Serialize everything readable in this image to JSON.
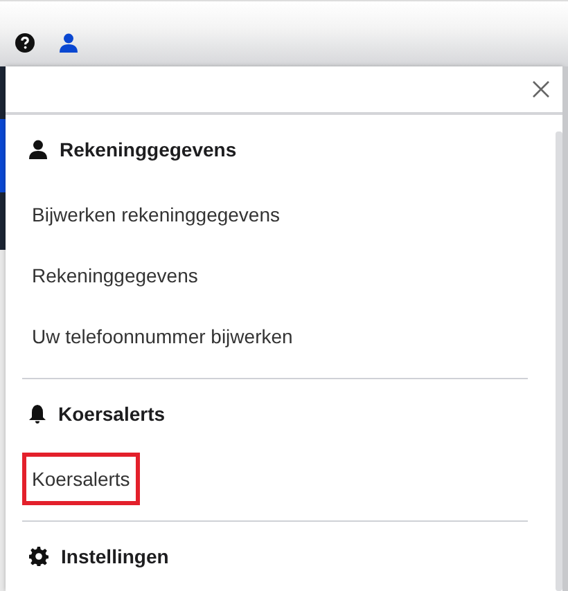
{
  "sections": [
    {
      "title": "Rekeninggegevens",
      "items": [
        {
          "label": "Bijwerken rekeninggegevens",
          "highlighted": false
        },
        {
          "label": "Rekeninggegevens",
          "highlighted": false
        },
        {
          "label": "Uw telefoonnummer bijwerken",
          "highlighted": false
        }
      ]
    },
    {
      "title": "Koersalerts",
      "items": [
        {
          "label": "Koersalerts",
          "highlighted": true
        }
      ]
    },
    {
      "title": "Instellingen"
    }
  ]
}
